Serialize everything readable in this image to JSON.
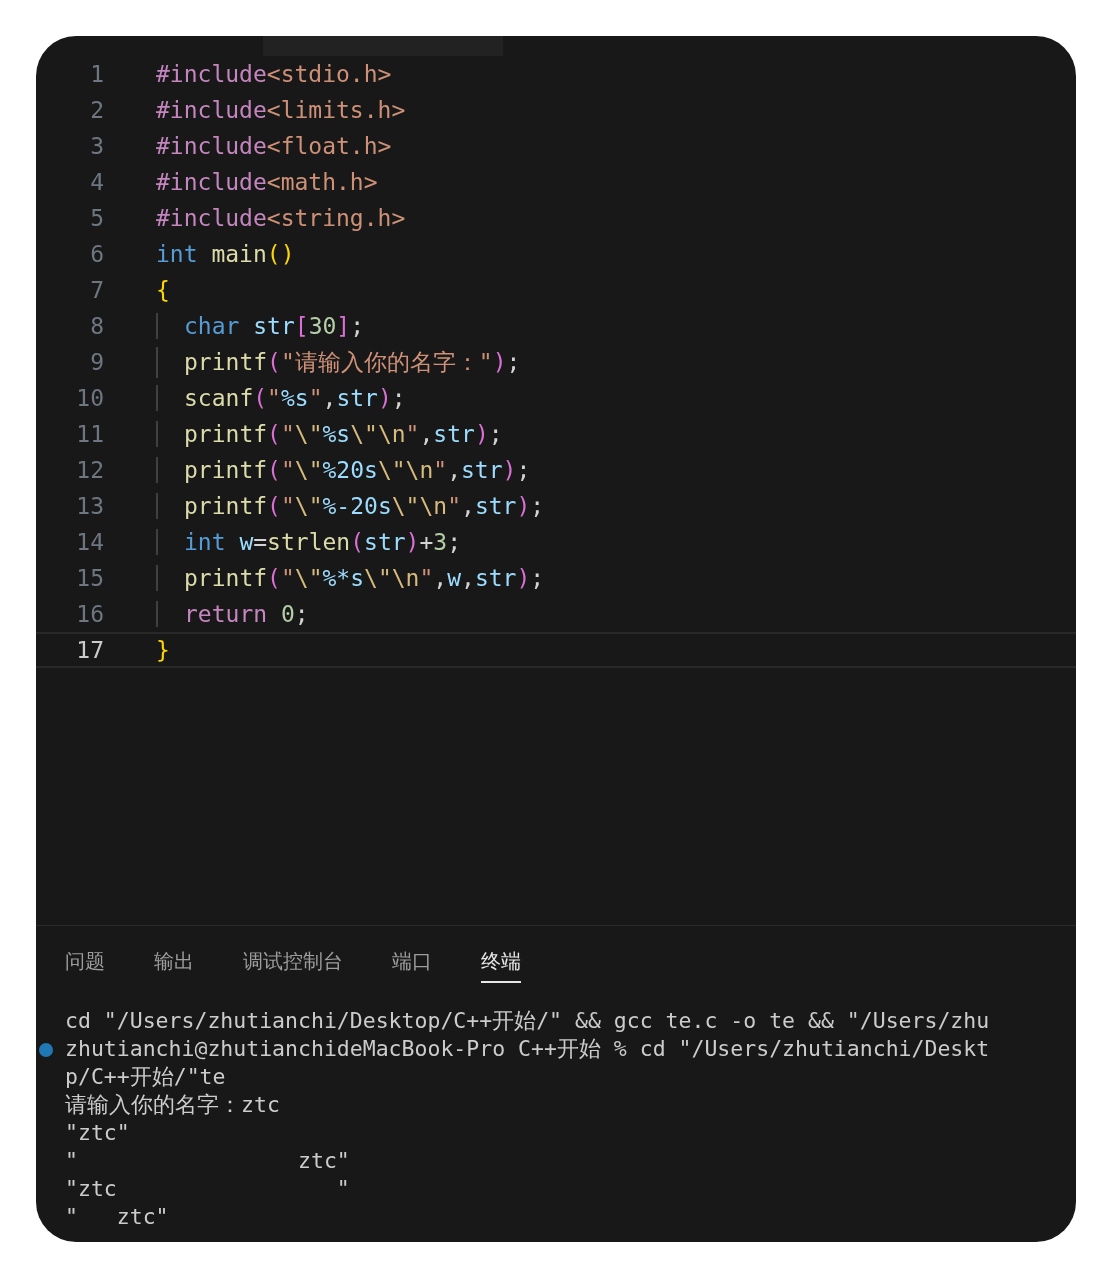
{
  "editor": {
    "lines": [
      {
        "number": "1",
        "tokens": [
          {
            "text": "#include",
            "kind": "directive"
          },
          {
            "text": "<stdio.h>",
            "kind": "string"
          }
        ]
      },
      {
        "number": "2",
        "tokens": [
          {
            "text": "#include",
            "kind": "directive"
          },
          {
            "text": "<limits.h>",
            "kind": "string"
          }
        ]
      },
      {
        "number": "3",
        "tokens": [
          {
            "text": "#include",
            "kind": "directive"
          },
          {
            "text": "<float.h>",
            "kind": "string"
          }
        ]
      },
      {
        "number": "4",
        "tokens": [
          {
            "text": "#include",
            "kind": "directive"
          },
          {
            "text": "<math.h>",
            "kind": "string"
          }
        ]
      },
      {
        "number": "5",
        "tokens": [
          {
            "text": "#include",
            "kind": "directive"
          },
          {
            "text": "<string.h>",
            "kind": "string"
          }
        ]
      },
      {
        "number": "6",
        "tokens": [
          {
            "text": "int ",
            "kind": "type"
          },
          {
            "text": "main",
            "kind": "function"
          },
          {
            "text": "()",
            "kind": "brace"
          }
        ]
      },
      {
        "number": "7",
        "tokens": [
          {
            "text": "{",
            "kind": "brace"
          }
        ]
      },
      {
        "number": "8",
        "indent": true,
        "tokens": [
          {
            "text": "char ",
            "kind": "type"
          },
          {
            "text": "str",
            "kind": "variable"
          },
          {
            "text": "[",
            "kind": "bracket"
          },
          {
            "text": "30",
            "kind": "number"
          },
          {
            "text": "]",
            "kind": "bracket"
          },
          {
            "text": ";",
            "kind": "plain"
          }
        ]
      },
      {
        "number": "9",
        "indent": true,
        "tokens": [
          {
            "text": "printf",
            "kind": "function"
          },
          {
            "text": "(",
            "kind": "bracket"
          },
          {
            "text": "\"请输入你的名字：\"",
            "kind": "string"
          },
          {
            "text": ")",
            "kind": "bracket"
          },
          {
            "text": ";",
            "kind": "plain"
          }
        ]
      },
      {
        "number": "10",
        "indent": true,
        "tokens": [
          {
            "text": "scanf",
            "kind": "function"
          },
          {
            "text": "(",
            "kind": "bracket"
          },
          {
            "text": "\"",
            "kind": "string"
          },
          {
            "text": "%s",
            "kind": "variable"
          },
          {
            "text": "\"",
            "kind": "string"
          },
          {
            "text": ",",
            "kind": "plain"
          },
          {
            "text": "str",
            "kind": "variable"
          },
          {
            "text": ")",
            "kind": "bracket"
          },
          {
            "text": ";",
            "kind": "plain"
          }
        ]
      },
      {
        "number": "11",
        "indent": true,
        "tokens": [
          {
            "text": "printf",
            "kind": "function"
          },
          {
            "text": "(",
            "kind": "bracket"
          },
          {
            "text": "\"",
            "kind": "string"
          },
          {
            "text": "\\\"",
            "kind": "escape"
          },
          {
            "text": "%s",
            "kind": "variable"
          },
          {
            "text": "\\\"\\n",
            "kind": "escape"
          },
          {
            "text": "\"",
            "kind": "string"
          },
          {
            "text": ",",
            "kind": "plain"
          },
          {
            "text": "str",
            "kind": "variable"
          },
          {
            "text": ")",
            "kind": "bracket"
          },
          {
            "text": ";",
            "kind": "plain"
          }
        ]
      },
      {
        "number": "12",
        "indent": true,
        "tokens": [
          {
            "text": "printf",
            "kind": "function"
          },
          {
            "text": "(",
            "kind": "bracket"
          },
          {
            "text": "\"",
            "kind": "string"
          },
          {
            "text": "\\\"",
            "kind": "escape"
          },
          {
            "text": "%20s",
            "kind": "variable"
          },
          {
            "text": "\\\"\\n",
            "kind": "escape"
          },
          {
            "text": "\"",
            "kind": "string"
          },
          {
            "text": ",",
            "kind": "plain"
          },
          {
            "text": "str",
            "kind": "variable"
          },
          {
            "text": ")",
            "kind": "bracket"
          },
          {
            "text": ";",
            "kind": "plain"
          }
        ]
      },
      {
        "number": "13",
        "indent": true,
        "tokens": [
          {
            "text": "printf",
            "kind": "function"
          },
          {
            "text": "(",
            "kind": "bracket"
          },
          {
            "text": "\"",
            "kind": "string"
          },
          {
            "text": "\\\"",
            "kind": "escape"
          },
          {
            "text": "%-20s",
            "kind": "variable"
          },
          {
            "text": "\\\"\\n",
            "kind": "escape"
          },
          {
            "text": "\"",
            "kind": "string"
          },
          {
            "text": ",",
            "kind": "plain"
          },
          {
            "text": "str",
            "kind": "variable"
          },
          {
            "text": ")",
            "kind": "bracket"
          },
          {
            "text": ";",
            "kind": "plain"
          }
        ]
      },
      {
        "number": "14",
        "indent": true,
        "tokens": [
          {
            "text": "int ",
            "kind": "type"
          },
          {
            "text": "w",
            "kind": "variable"
          },
          {
            "text": "=",
            "kind": "plain"
          },
          {
            "text": "strlen",
            "kind": "function"
          },
          {
            "text": "(",
            "kind": "bracket"
          },
          {
            "text": "str",
            "kind": "variable"
          },
          {
            "text": ")",
            "kind": "bracket"
          },
          {
            "text": "+",
            "kind": "plain"
          },
          {
            "text": "3",
            "kind": "number"
          },
          {
            "text": ";",
            "kind": "plain"
          }
        ]
      },
      {
        "number": "15",
        "indent": true,
        "tokens": [
          {
            "text": "printf",
            "kind": "function"
          },
          {
            "text": "(",
            "kind": "bracket"
          },
          {
            "text": "\"",
            "kind": "string"
          },
          {
            "text": "\\\"",
            "kind": "escape"
          },
          {
            "text": "%*s",
            "kind": "variable"
          },
          {
            "text": "\\\"\\n",
            "kind": "escape"
          },
          {
            "text": "\"",
            "kind": "string"
          },
          {
            "text": ",",
            "kind": "plain"
          },
          {
            "text": "w",
            "kind": "variable"
          },
          {
            "text": ",",
            "kind": "plain"
          },
          {
            "text": "str",
            "kind": "variable"
          },
          {
            "text": ")",
            "kind": "bracket"
          },
          {
            "text": ";",
            "kind": "plain"
          }
        ]
      },
      {
        "number": "16",
        "indent": true,
        "tokens": [
          {
            "text": "return ",
            "kind": "control"
          },
          {
            "text": "0",
            "kind": "number"
          },
          {
            "text": ";",
            "kind": "plain"
          }
        ]
      },
      {
        "number": "17",
        "current": true,
        "tokens": [
          {
            "text": "}",
            "kind": "brace"
          }
        ]
      }
    ]
  },
  "panel": {
    "tabs": [
      {
        "label": "问题",
        "selected": false
      },
      {
        "label": "输出",
        "selected": false
      },
      {
        "label": "调试控制台",
        "selected": false
      },
      {
        "label": "端口",
        "selected": false
      },
      {
        "label": "终端",
        "selected": true
      }
    ],
    "terminal": [
      {
        "text": "cd \"/Users/zhutianchi/Desktop/C++开始/\" && gcc te.c -o te && \"/Users/zhu",
        "marker": false
      },
      {
        "text": "zhutianchi@zhutianchideMacBook-Pro C++开始 % cd \"/Users/zhutianchi/Deskt",
        "marker": true
      },
      {
        "text": "p/C++开始/\"te",
        "marker": false
      },
      {
        "text": "请输入你的名字：ztc",
        "marker": false
      },
      {
        "text": "\"ztc\"",
        "marker": false
      },
      {
        "text": "\"                 ztc\"",
        "marker": false
      },
      {
        "text": "\"ztc                 \"",
        "marker": false
      },
      {
        "text": "\"   ztc\"",
        "marker": false
      }
    ]
  }
}
